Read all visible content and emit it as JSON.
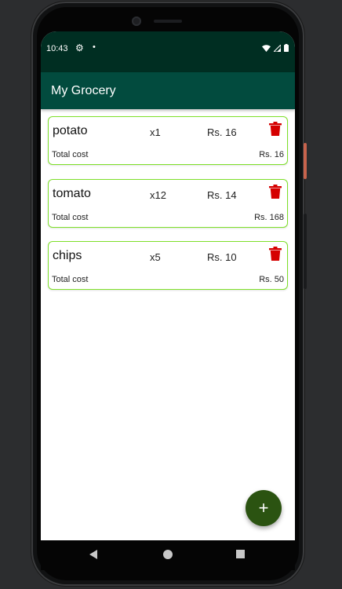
{
  "status_bar": {
    "time": "10:43",
    "dot": "•"
  },
  "app_bar": {
    "title": "My Grocery"
  },
  "items": [
    {
      "name": "potato",
      "quantity": "x1",
      "price": "Rs. 16",
      "total_label": "Total cost",
      "total_value": "Rs. 16"
    },
    {
      "name": "tomato",
      "quantity": "x12",
      "price": "Rs. 14",
      "total_label": "Total cost",
      "total_value": "Rs. 168"
    },
    {
      "name": "chips",
      "quantity": "x5",
      "price": "Rs. 10",
      "total_label": "Total cost",
      "total_value": "Rs. 50"
    }
  ],
  "fab": {
    "label": "+",
    "icon": "add-icon"
  },
  "colors": {
    "status_bar": "#002e22",
    "app_bar": "#024b3e",
    "card_border": "#7ee02a",
    "delete_icon": "#d50000",
    "fab": "#2b5311"
  }
}
